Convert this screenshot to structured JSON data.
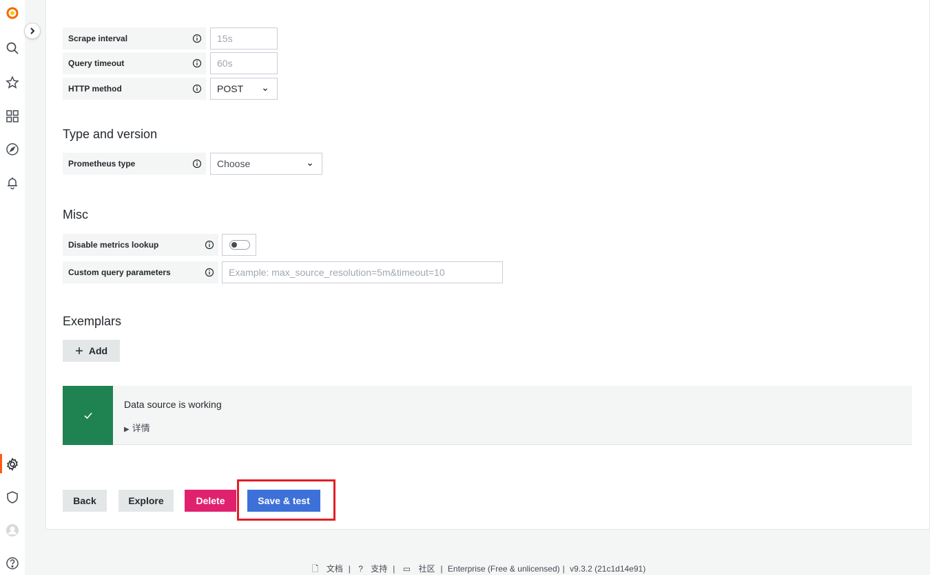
{
  "sidebar": {
    "items": [
      "grafana-logo-icon",
      "search-icon",
      "star-icon",
      "dashboards-icon",
      "explore-icon",
      "alerting-icon",
      "configuration-icon",
      "shield-icon",
      "avatar",
      "help-icon"
    ],
    "accent": "#ff5a14"
  },
  "http": {
    "scrape_interval": {
      "label": "Scrape interval",
      "placeholder": "15s"
    },
    "query_timeout": {
      "label": "Query timeout",
      "placeholder": "60s"
    },
    "http_method": {
      "label": "HTTP method",
      "value": "POST"
    }
  },
  "type_version": {
    "title": "Type and version",
    "prometheus_type": {
      "label": "Prometheus type",
      "value": "Choose"
    }
  },
  "misc": {
    "title": "Misc",
    "disable_metrics_lookup": {
      "label": "Disable metrics lookup",
      "enabled": false
    },
    "custom_query_params": {
      "label": "Custom query parameters",
      "placeholder": "Example: max_source_resolution=5m&timeout=10"
    }
  },
  "exemplars": {
    "title": "Exemplars",
    "add_label": "Add"
  },
  "alert": {
    "title": "Data source is working",
    "details": "详情",
    "color": "#1f8251"
  },
  "actions": {
    "back": "Back",
    "explore": "Explore",
    "delete": "Delete",
    "save_test": "Save & test"
  },
  "footer": {
    "docs": "文档",
    "support": "支持",
    "community": "社区",
    "edition": "Enterprise (Free & unlicensed)",
    "version": "v9.3.2 (21c1d14e91)"
  }
}
